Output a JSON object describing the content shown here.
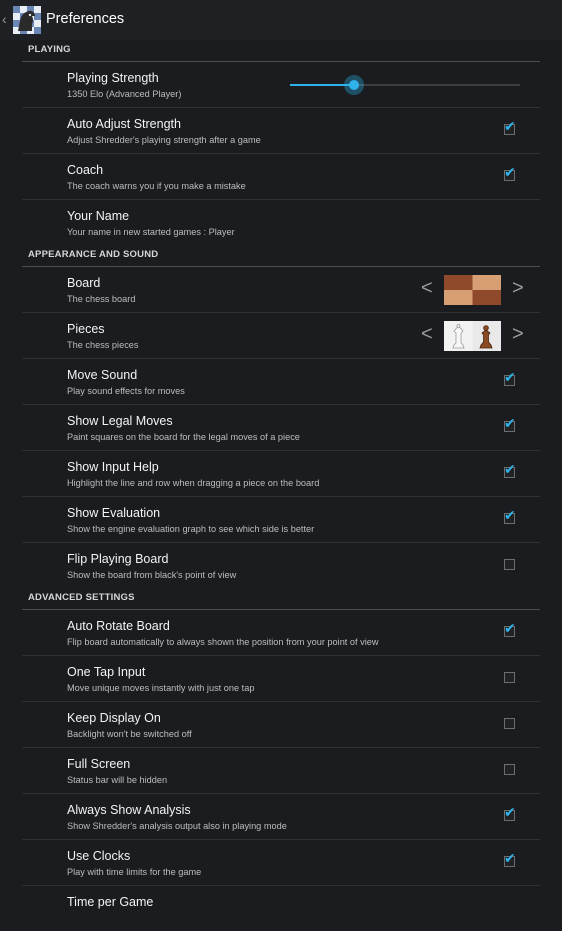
{
  "header": {
    "title": "Preferences",
    "icon": "chess-app-icon"
  },
  "playing": {
    "section_label": "PLAYING",
    "strength": {
      "title": "Playing Strength",
      "summary": "1350 Elo (Advanced Player)",
      "slider_fraction": 0.28
    },
    "auto_adjust": {
      "title": "Auto Adjust Strength",
      "summary": "Adjust Shredder's playing strength after a game",
      "checked": true
    },
    "coach": {
      "title": "Coach",
      "summary": "The coach warns you if you make a mistake",
      "checked": true
    },
    "your_name": {
      "title": "Your Name",
      "summary": "Your name in new started games : Player"
    }
  },
  "appearance": {
    "section_label": "APPEARANCE AND SOUND",
    "board": {
      "title": "Board",
      "summary": "The chess board",
      "prev": "<",
      "next": ">"
    },
    "pieces": {
      "title": "Pieces",
      "summary": "The chess pieces",
      "prev": "<",
      "next": ">"
    },
    "move_sound": {
      "title": "Move Sound",
      "summary": "Play sound effects for moves",
      "checked": true
    },
    "legal_moves": {
      "title": "Show Legal Moves",
      "summary": "Paint squares on the board for the legal moves of a piece",
      "checked": true
    },
    "input_help": {
      "title": "Show Input Help",
      "summary": "Highlight the line and row when dragging a piece on the board",
      "checked": true
    },
    "evaluation": {
      "title": "Show Evaluation",
      "summary": "Show the engine evaluation graph to see which side is better",
      "checked": true
    },
    "flip_board": {
      "title": "Flip Playing Board",
      "summary": "Show the board from black's point of view",
      "checked": false
    }
  },
  "advanced": {
    "section_label": "ADVANCED SETTINGS",
    "auto_rotate": {
      "title": "Auto Rotate Board",
      "summary": "Flip board automatically to always shown the position from your point of view",
      "checked": true
    },
    "one_tap": {
      "title": "One Tap Input",
      "summary": "Move unique moves instantly with just one tap",
      "checked": false
    },
    "keep_display": {
      "title": "Keep Display On",
      "summary": "Backlight won't be switched off",
      "checked": false
    },
    "full_screen": {
      "title": "Full Screen",
      "summary": "Status bar will be hidden",
      "checked": false
    },
    "always_analysis": {
      "title": "Always Show Analysis",
      "summary": "Show Shredder's analysis output also in playing mode",
      "checked": true
    },
    "use_clocks": {
      "title": "Use Clocks",
      "summary": "Play with time limits for the game",
      "checked": true
    },
    "time_control": {
      "title": "Time per Game"
    }
  },
  "colors": {
    "accent": "#2fb3ea",
    "background": "#1a1c1f"
  }
}
